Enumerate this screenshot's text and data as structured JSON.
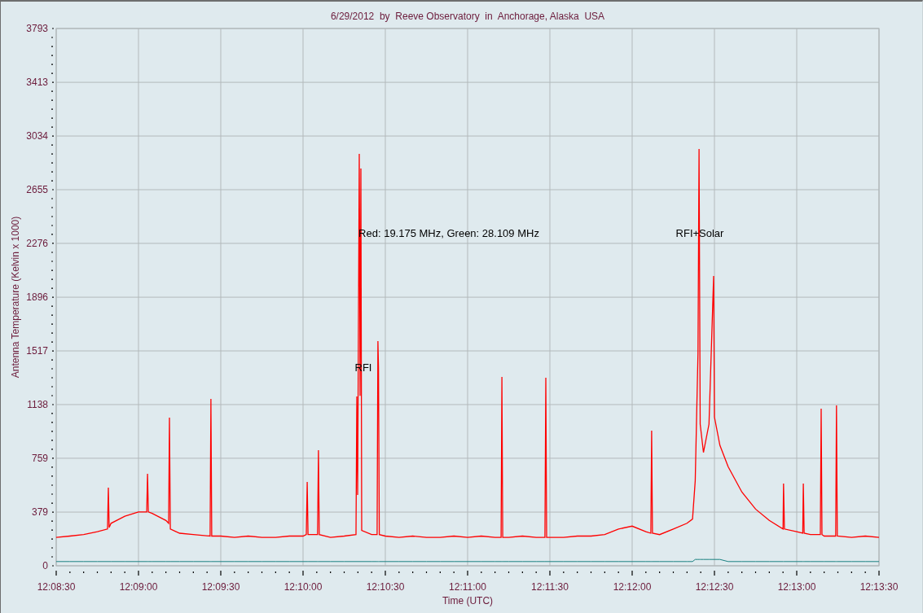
{
  "chart": {
    "chart_data": {
      "type": "line",
      "title": "6/29/2012  by  Reeve Observatory  in  Anchorage, Alaska  USA",
      "xlabel": "Time (UTC)",
      "ylabel": "Antenna Temperature (Kelvin x 1000)",
      "x": [
        43710,
        43715,
        43720,
        43725,
        43728.7,
        43729,
        43729.3,
        43730,
        43735,
        43740,
        43743,
        43743.3,
        43743.6,
        43745,
        43750,
        43751,
        43751.3,
        43751.6,
        43755,
        43760,
        43766.1,
        43766.4,
        43766.7,
        43770,
        43775,
        43780,
        43785,
        43790,
        43795,
        43800,
        43801.2,
        43801.5,
        43801.8,
        43805.3,
        43805.6,
        43805.9,
        43810,
        43815,
        43819.3,
        43819.6,
        43819.9,
        43820.5,
        43820.8,
        43821.1,
        43821.4,
        43825,
        43827,
        43827.3,
        43827.5,
        43827.8,
        43830,
        43835,
        43840,
        43845,
        43850,
        43855,
        43860,
        43865,
        43870,
        43872.2,
        43872.5,
        43872.8,
        43875,
        43880,
        43885,
        43888.2,
        43888.5,
        43888.8,
        43890,
        43895,
        43900,
        43905,
        43910,
        43915,
        43920,
        43925,
        43926.8,
        43927.1,
        43927.4,
        43930,
        43935,
        43940,
        43942,
        43943,
        43944,
        43944.4,
        43944.8,
        43946,
        43948,
        43949.7,
        43950,
        43952,
        43955,
        43960,
        43965,
        43970,
        43975,
        43975.2,
        43975.5,
        43980,
        43982.2,
        43982.4,
        43982.7,
        43985,
        43988.6,
        43988.9,
        43989.2,
        43990,
        43994.2,
        43994.5,
        43994.8,
        44000,
        44005,
        44010
      ],
      "series": [
        {
          "color": "#ff0000",
          "values": [
            200,
            210,
            220,
            240,
            260,
            552,
            270,
            300,
            350,
            380,
            380,
            650,
            380,
            370,
            320,
            300,
            1046,
            260,
            230,
            220,
            210,
            1178,
            210,
            210,
            200,
            210,
            200,
            200,
            210,
            210,
            220,
            592,
            220,
            220,
            816,
            220,
            200,
            210,
            220,
            1195,
            500,
            2908,
            1200,
            2804,
            250,
            220,
            220,
            1586,
            1402,
            220,
            210,
            200,
            210,
            200,
            200,
            210,
            200,
            210,
            200,
            200,
            1333,
            200,
            200,
            210,
            200,
            200,
            1328,
            200,
            200,
            200,
            210,
            210,
            220,
            260,
            280,
            240,
            230,
            954,
            230,
            220,
            260,
            300,
            330,
            600,
            1500,
            2942,
            1000,
            800,
            1000,
            2046,
            1050,
            850,
            700,
            520,
            400,
            320,
            260,
            580,
            260,
            240,
            230,
            580,
            230,
            220,
            220,
            1109,
            220,
            210,
            210,
            1132,
            210,
            200,
            210,
            200
          ]
        },
        {
          "color": "#1a8080",
          "values": [
            30,
            30,
            30,
            30,
            30,
            30,
            30,
            30,
            30,
            30,
            30,
            30,
            30,
            30,
            30,
            30,
            30,
            30,
            30,
            30,
            30,
            30,
            30,
            30,
            30,
            30,
            30,
            30,
            30,
            30,
            30,
            30,
            30,
            30,
            30,
            30,
            30,
            30,
            30,
            30,
            30,
            30,
            30,
            30,
            30,
            30,
            30,
            30,
            30,
            30,
            30,
            30,
            30,
            30,
            30,
            30,
            30,
            30,
            30,
            30,
            30,
            30,
            30,
            30,
            30,
            30,
            30,
            30,
            30,
            30,
            30,
            30,
            30,
            30,
            30,
            30,
            30,
            30,
            30,
            30,
            30,
            30,
            30,
            45,
            45,
            45,
            45,
            45,
            45,
            45,
            45,
            45,
            30,
            30,
            30,
            30,
            30,
            30,
            30,
            30,
            30,
            30,
            30,
            30,
            30,
            30,
            30,
            30,
            30,
            30,
            30,
            30,
            30,
            30
          ]
        }
      ],
      "xlim": [
        43710,
        44010
      ],
      "ylim": [
        0,
        3793
      ],
      "grid": true,
      "xticks": [
        {
          "value": 43710,
          "label": "12:08:30"
        },
        {
          "value": 43740,
          "label": "12:09:00"
        },
        {
          "value": 43770,
          "label": "12:09:30"
        },
        {
          "value": 43800,
          "label": "12:10:00"
        },
        {
          "value": 43830,
          "label": "12:10:30"
        },
        {
          "value": 43860,
          "label": "12:11:00"
        },
        {
          "value": 43890,
          "label": "12:11:30"
        },
        {
          "value": 43920,
          "label": "12:12:00"
        },
        {
          "value": 43950,
          "label": "12:12:30"
        },
        {
          "value": 43980,
          "label": "12:13:00"
        },
        {
          "value": 44010,
          "label": "12:13:30"
        }
      ],
      "yticks": [
        0,
        379,
        759,
        1138,
        1517,
        1896,
        2276,
        2655,
        3034,
        3413,
        3793
      ],
      "annotations": [
        "Red: 19.175 MHz, Green: 28.109 MHz",
        "RFI",
        "RFI+Solar"
      ]
    }
  }
}
